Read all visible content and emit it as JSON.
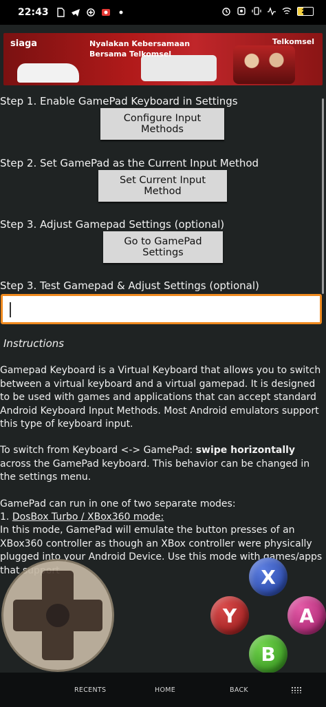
{
  "status_bar": {
    "time": "22:43",
    "battery_level": "21",
    "left_icons": [
      "sim-icon",
      "telegram-icon",
      "gamepad-app-icon",
      "screen-record-icon",
      "dot-icon"
    ],
    "right_icons": [
      "alarm-icon",
      "data-saver-icon",
      "vibrate-icon",
      "signal-icon",
      "wifi-icon",
      "battery-icon"
    ]
  },
  "ad_banner": {
    "brand_left": "siaga",
    "headline_line1": "Nyalakan Kebersamaan",
    "headline_line2": "Bersama Telkomsel",
    "brand_right": "Telkomsel"
  },
  "steps": [
    {
      "label": "Step 1. Enable GamePad Keyboard in Settings",
      "button": "Configure Input Methods"
    },
    {
      "label": "Step 2. Set GamePad as the Current Input Method",
      "button": "Set Current Input Method"
    },
    {
      "label": "Step 3. Adjust Gamepad Settings (optional)",
      "button": "Go to GamePad Settings"
    },
    {
      "label": "Step 3. Test Gamepad & Adjust Settings (optional)"
    }
  ],
  "test_input": {
    "value": ""
  },
  "instructions": {
    "title": "Instructions",
    "p1": " Gamepad Keyboard is a Virtual Keyboard that allows you to switch between a virtual keyboard and a virtual gamepad. It is designed to be used with games and applications that can accept standard Android Keyboard Input Methods. Most Android emulators support this type of keyboard input.",
    "p2_pre": " To switch from Keyboard <-> GamePad: ",
    "p2_bold": "swipe horizontally",
    "p2_post": " across the GamePad keyboard. This behavior can be changed in the settings menu.",
    "p3": " GamePad can run in one of two separate modes:",
    "mode1_prefix": " 1. ",
    "mode1_title": "DosBox Turbo / XBox360 mode:",
    "p4": " In this mode, GamePad will emulate the button presses of an XBox360 controller as though an XBox controller were physically plugged into your Android Device. Use this mode with games/apps that support"
  },
  "gamepad": {
    "buttons": {
      "x": "X",
      "y": "Y",
      "a": "A",
      "b": "B"
    }
  },
  "nav_bar": {
    "recents": "RECENTS",
    "home": "HOME",
    "back": "BACK"
  }
}
